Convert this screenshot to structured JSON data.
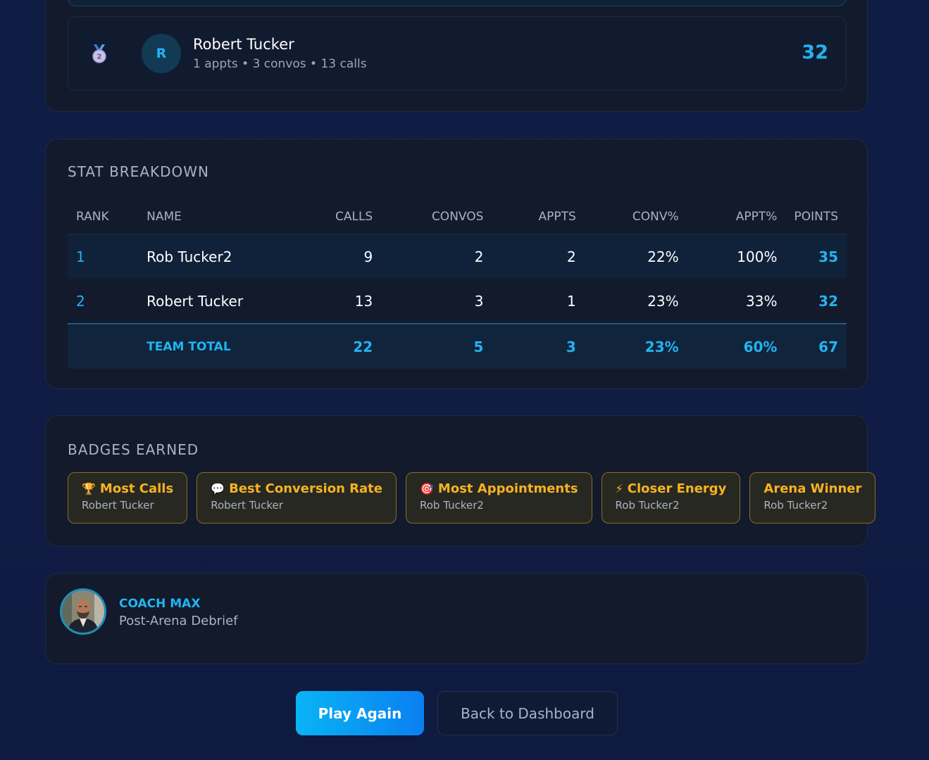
{
  "leaderboard": {
    "player": {
      "rank_medal": "2",
      "initial": "R",
      "name": "Robert Tucker",
      "summary": "1 appts • 3 convos • 13 calls",
      "points": "32"
    }
  },
  "stats": {
    "title": "STAT BREAKDOWN",
    "columns": [
      "RANK",
      "NAME",
      "CALLS",
      "CONVOS",
      "APPTS",
      "CONV%",
      "APPT%",
      "POINTS"
    ],
    "rows": [
      {
        "rank": "1",
        "name": "Rob Tucker2",
        "calls": "9",
        "convos": "2",
        "appts": "2",
        "conv_pct": "22%",
        "appt_pct": "100%",
        "points": "35"
      },
      {
        "rank": "2",
        "name": "Robert Tucker",
        "calls": "13",
        "convos": "3",
        "appts": "1",
        "conv_pct": "23%",
        "appt_pct": "33%",
        "points": "32"
      }
    ],
    "total": {
      "label": "TEAM TOTAL",
      "calls": "22",
      "convos": "5",
      "appts": "3",
      "conv_pct": "23%",
      "appt_pct": "60%",
      "points": "67"
    }
  },
  "badges": {
    "title": "BADGES EARNED",
    "items": [
      {
        "icon": "🏆",
        "icon_name": "trophy-icon",
        "label": "Most Calls",
        "winner": "Robert Tucker"
      },
      {
        "icon": "💬",
        "icon_name": "speech-bubble-icon",
        "label": "Best Conversion Rate",
        "winner": "Robert Tucker"
      },
      {
        "icon": "🎯",
        "icon_name": "target-icon",
        "label": "Most Appointments",
        "winner": "Rob Tucker2"
      },
      {
        "icon": "⚡",
        "icon_name": "lightning-icon",
        "label": "Closer Energy",
        "winner": "Rob Tucker2"
      },
      {
        "icon": "",
        "icon_name": "",
        "label": "Arena Winner",
        "winner": "Rob Tucker2"
      }
    ]
  },
  "coach": {
    "name": "COACH MAX",
    "subtitle": "Post-Arena Debrief"
  },
  "actions": {
    "play_again": "Play Again",
    "back": "Back to Dashboard"
  },
  "colors": {
    "accent": "#22b4f0",
    "badge_gold": "#f5b323",
    "background": "#0f1b3d"
  }
}
